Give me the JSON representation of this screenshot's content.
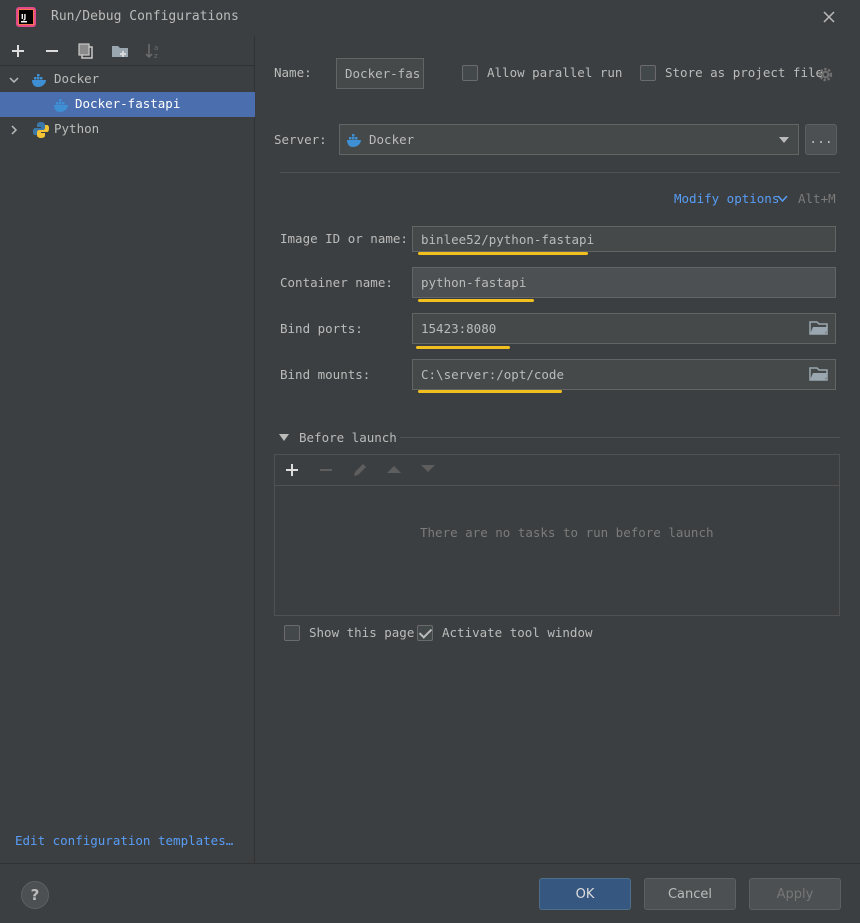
{
  "window": {
    "title": "Run/Debug Configurations"
  },
  "tree": {
    "items": [
      {
        "label": "Docker"
      },
      {
        "label": "Docker-fastapi"
      },
      {
        "label": "Python"
      }
    ],
    "edit_templates": "Edit configuration templates…"
  },
  "form": {
    "name_label": "Name:",
    "name_value": "Docker-fas",
    "allow_parallel": "Allow parallel run",
    "store_project": "Store as project file",
    "server_label": "Server:",
    "server_value": "Docker",
    "server_more": "...",
    "modify_options": "Modify options",
    "modify_shortcut": "Alt+M",
    "image_label": "Image ID or name:",
    "image_value": "binlee52/python-fastapi",
    "container_label": "Container name:",
    "container_value": "python-fastapi",
    "ports_label": "Bind ports:",
    "ports_value": "15423:8080",
    "mounts_label": "Bind mounts:",
    "mounts_value": "C:\\server:/opt/code",
    "before_launch_label": "Before launch",
    "no_tasks": "There are no tasks to run before launch",
    "show_page": "Show this page",
    "activate_tool": "Activate tool window",
    "show_page_checked": false,
    "activate_tool_checked": true
  },
  "buttons": {
    "ok": "OK",
    "cancel": "Cancel",
    "apply": "Apply",
    "help": "?"
  },
  "colors": {
    "accent": "#589df6",
    "selection": "#4b6eaf",
    "highlight": "#f2c01e",
    "primary_button": "#365880"
  }
}
